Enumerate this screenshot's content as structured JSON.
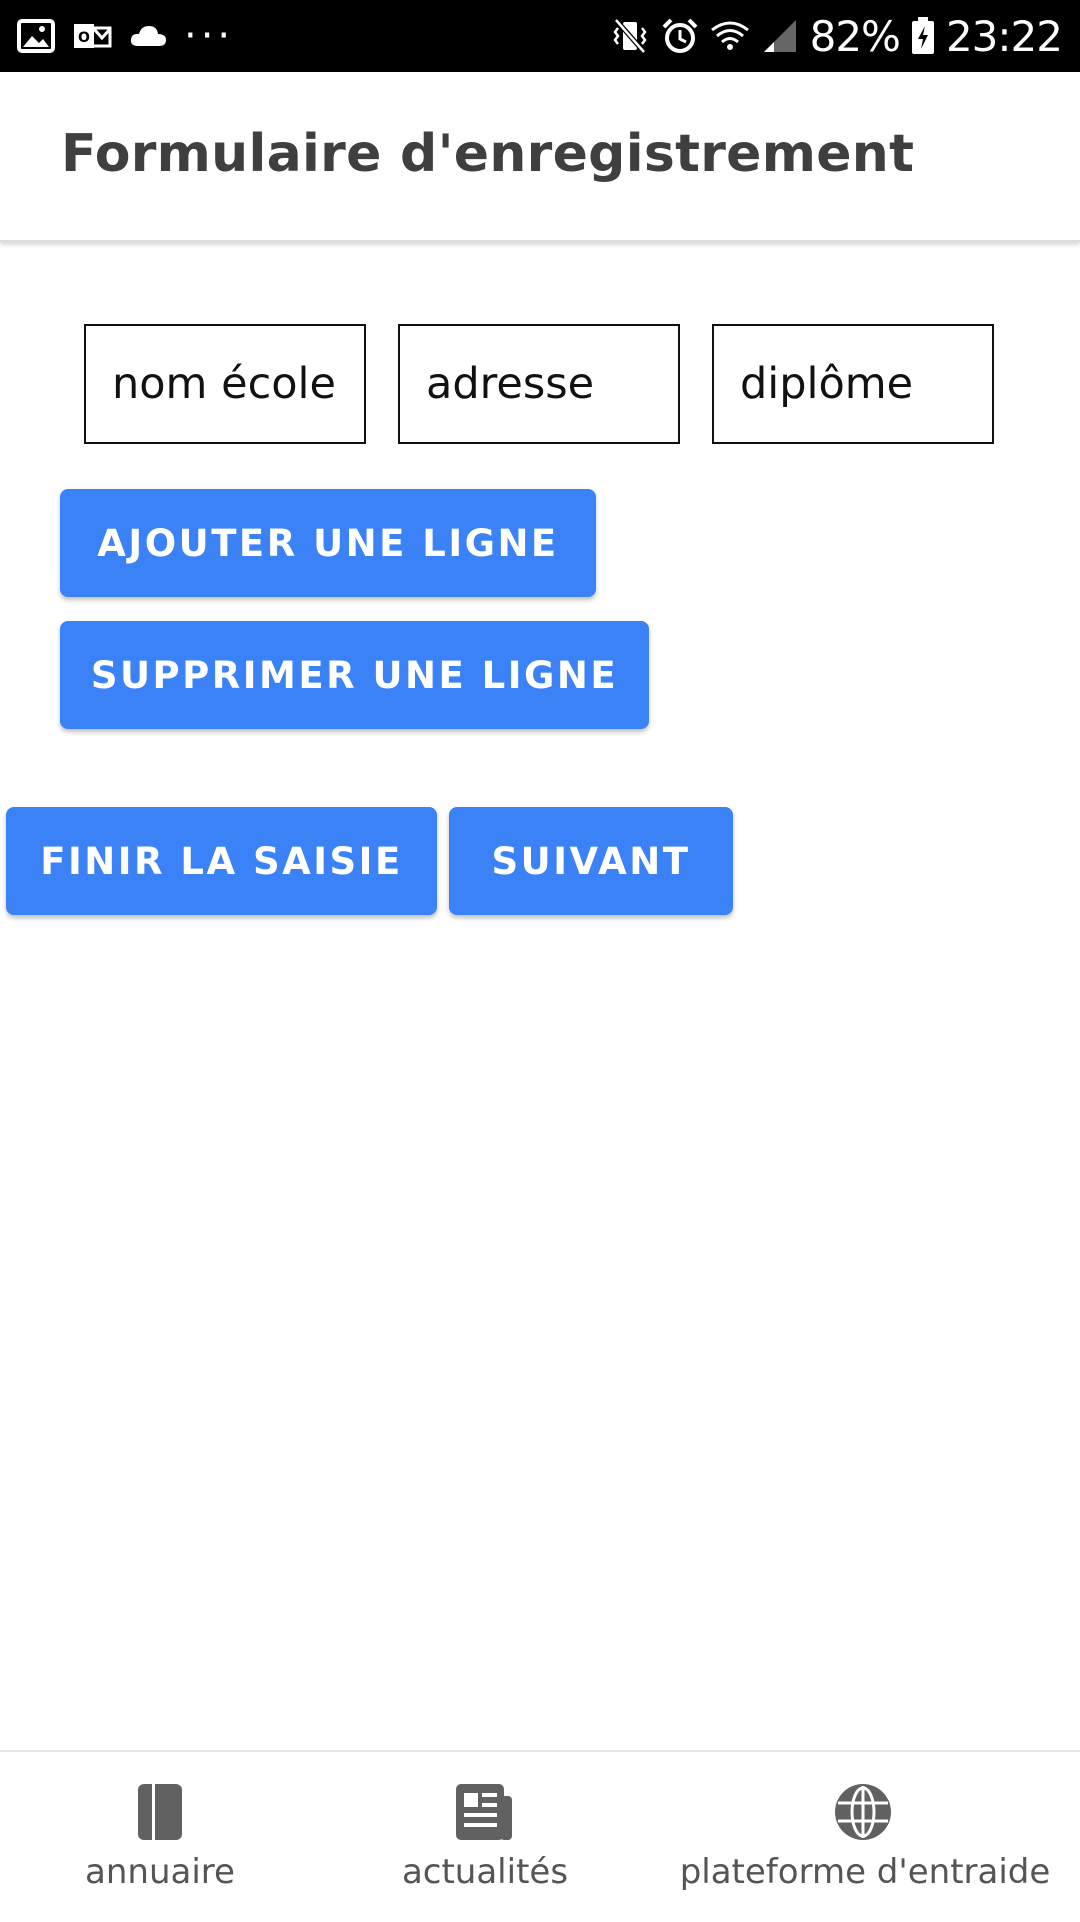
{
  "status_bar": {
    "left_icons": [
      "gallery-icon",
      "outlook-icon",
      "cloud-icon",
      "more-dots-icon"
    ],
    "right_icons": [
      "vibrate-icon",
      "alarm-icon",
      "wifi-icon",
      "signal-icon",
      "battery-charging-icon"
    ],
    "battery": "82%",
    "time": "23:22",
    "more": "···"
  },
  "app_bar": {
    "title": "Formulaire d'enregistrement"
  },
  "form": {
    "fields": [
      {
        "placeholder": "nom école"
      },
      {
        "placeholder": "adresse"
      },
      {
        "placeholder": "diplôme"
      }
    ],
    "add_row_label": "AJOUTER UNE LIGNE",
    "remove_row_label": "SUPPRIMER UNE LIGNE",
    "finish_label": "FINIR LA SAISIE",
    "next_label": "SUIVANT"
  },
  "bottom_nav": {
    "items": [
      {
        "label": "annuaire",
        "icon": "book-icon"
      },
      {
        "label": "actualités",
        "icon": "newspaper-icon"
      },
      {
        "label": "plateforme d'entraide",
        "icon": "globe-icon"
      }
    ]
  },
  "colors": {
    "accent": "#3b82f6",
    "title": "#3f3f3f",
    "nav_icon": "#616161",
    "nav_label": "#555555"
  }
}
